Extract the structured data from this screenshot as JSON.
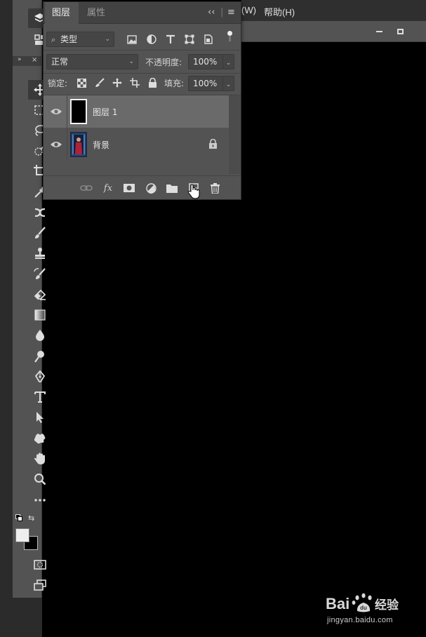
{
  "menubar": {
    "items": [
      {
        "label": "(W)"
      },
      {
        "label": "帮助(H)"
      }
    ]
  },
  "layers_panel": {
    "tabs": [
      {
        "label": "图层",
        "active": true
      },
      {
        "label": "属性",
        "active": false
      }
    ],
    "filter": {
      "kind_label": "类型"
    },
    "blend_mode": "正常",
    "opacity_label": "不透明度:",
    "opacity_value": "100%",
    "lock_label": "锁定:",
    "fill_label": "填充:",
    "fill_value": "100%",
    "layers": [
      {
        "name": "图层 1",
        "selected": true,
        "visible": true,
        "locked": false,
        "thumb": "black"
      },
      {
        "name": "背景",
        "selected": false,
        "visible": true,
        "locked": true,
        "thumb": "photo"
      }
    ],
    "footer_buttons": [
      "link-layers",
      "fx",
      "add-mask",
      "adjustment",
      "new-group",
      "new-layer",
      "delete"
    ]
  },
  "toolbar": {
    "tools": [
      "move",
      "marquee",
      "lasso",
      "quick-select",
      "crop",
      "eyedropper",
      "healing",
      "brush",
      "stamp",
      "history-brush",
      "eraser",
      "gradient",
      "blur",
      "dodge",
      "pen",
      "type",
      "path-select",
      "shape",
      "hand",
      "zoom",
      "more"
    ],
    "foreground_color": "#eeeeee",
    "background_color": "#000000"
  },
  "watermark": {
    "site": "jingyan.baidu.com",
    "brand": "Bai 经验"
  },
  "colors": {
    "panel": "#535353",
    "tabbar": "#424242",
    "selected_row": "#6a6a6a",
    "canvas": "#000000"
  }
}
